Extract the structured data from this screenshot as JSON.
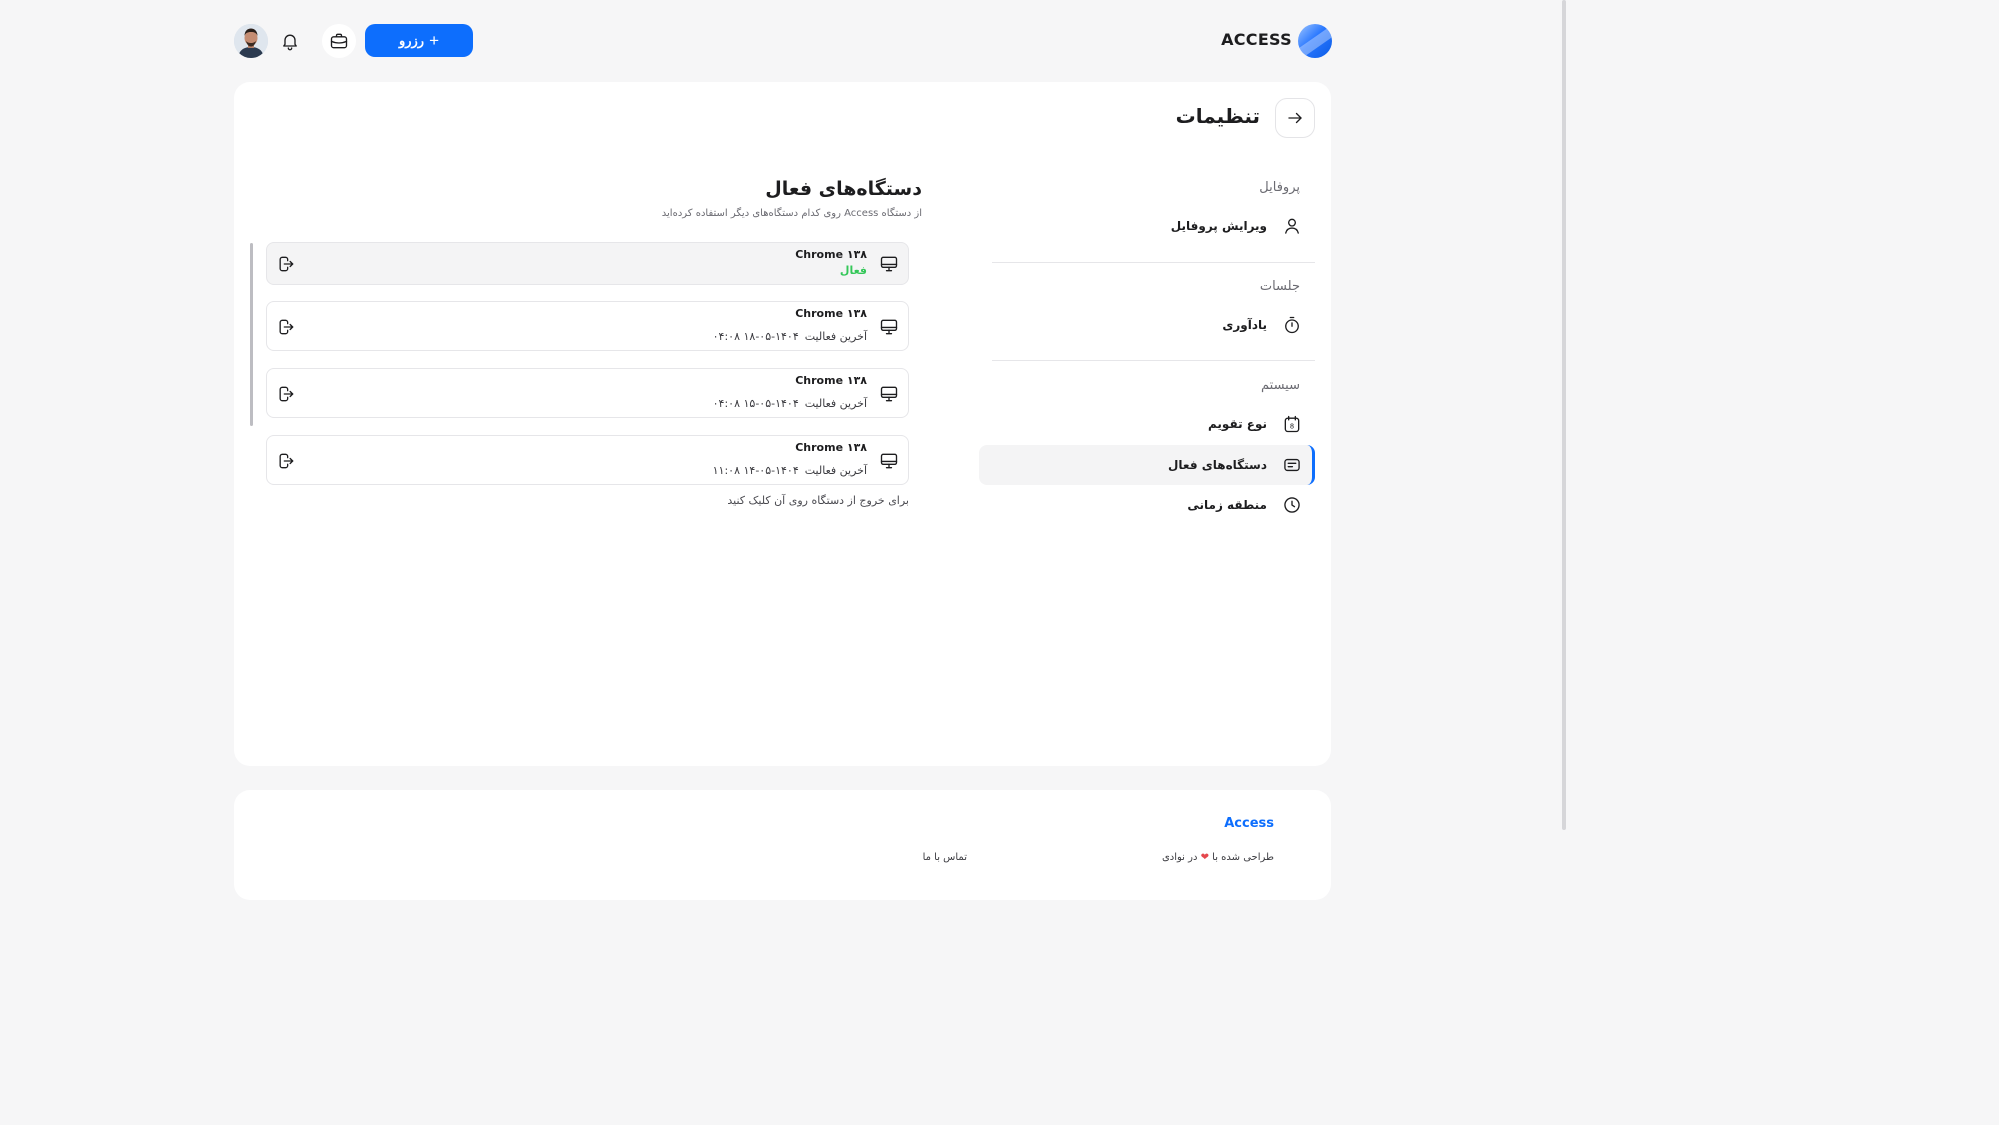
{
  "header": {
    "brand_name": "ACCESS",
    "reserve_label": "رزرو",
    "reserve_plus": "+"
  },
  "page": {
    "title": "تنظیمات"
  },
  "sidebar": {
    "sections": [
      {
        "label": "پروفایل",
        "items": [
          {
            "label": "ویرایش پروفایل",
            "icon": "user-icon"
          }
        ]
      },
      {
        "label": "جلسات",
        "items": [
          {
            "label": "یادآوری",
            "icon": "timer-icon"
          }
        ]
      },
      {
        "label": "سیستم",
        "items": [
          {
            "label": "نوع تقویم",
            "icon": "calendar-icon"
          },
          {
            "label": "دستگاه‌های فعال",
            "icon": "devices-icon",
            "active": true
          },
          {
            "label": "منطقه زمانی",
            "icon": "clock-icon"
          }
        ]
      }
    ]
  },
  "devices_panel": {
    "title": "دستگاه‌های فعال",
    "subtitle": "از دستگاه Access روی کدام دستگاه‌های دیگر استفاده کرده‌اید",
    "last_activity_label": "آخرین فعالیت",
    "devices": [
      {
        "name": "Chrome ۱۳۸",
        "status": "فعال",
        "current": true
      },
      {
        "name": "Chrome ۱۳۸",
        "last_activity": "۱۴۰۴-۰۵-۱۸ ۰۴:۰۸"
      },
      {
        "name": "Chrome ۱۳۸",
        "last_activity": "۱۴۰۴-۰۵-۱۵ ۰۴:۰۸"
      },
      {
        "name": "Chrome ۱۳۸",
        "last_activity": "۱۴۰۴-۰۵-۱۴ ۱۱:۰۸"
      }
    ],
    "hint": "برای خروج از دستگاه روی آن کلیک کنید"
  },
  "footer": {
    "brand": "Access",
    "made_prefix": "طراحی شده با",
    "made_suffix": "در نوادی",
    "contact": "تماس با ما"
  },
  "colors": {
    "accent": "#0d6efd",
    "active_status": "#34c759",
    "heart": "#e5484d"
  }
}
